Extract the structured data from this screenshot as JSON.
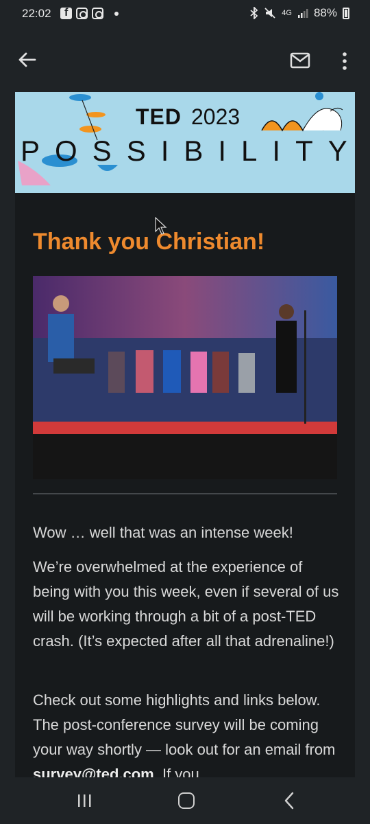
{
  "status": {
    "time": "22:02",
    "battery": "88%",
    "network": "4G"
  },
  "icons": [
    "back-arrow-icon",
    "mail-icon",
    "more-vert-icon",
    "facebook-icon",
    "instagram-icon",
    "bluetooth-icon",
    "mute-icon",
    "signal-icon",
    "battery-icon"
  ],
  "banner": {
    "ted": "TED",
    "year": "2023",
    "theme": "POSSIBILITY"
  },
  "email": {
    "title": "Thank you Christian!",
    "p1": "Wow … well that was an intense week!",
    "p2": "We’re overwhelmed at the experience of being with you this week, even if several of us will be working through a bit of a post-TED crash. (It’s expected after all that adrenaline!)",
    "p3_a": "Check out some highlights and links below. The post-conference survey will be coming your way shortly — look out for an email from ",
    "p3_email": "survey@ted.com",
    "p3_b": ". If you"
  },
  "colors": {
    "accent": "#ee8a2e",
    "banner_bg": "#a9d8ea",
    "bg": "#1f2326"
  }
}
